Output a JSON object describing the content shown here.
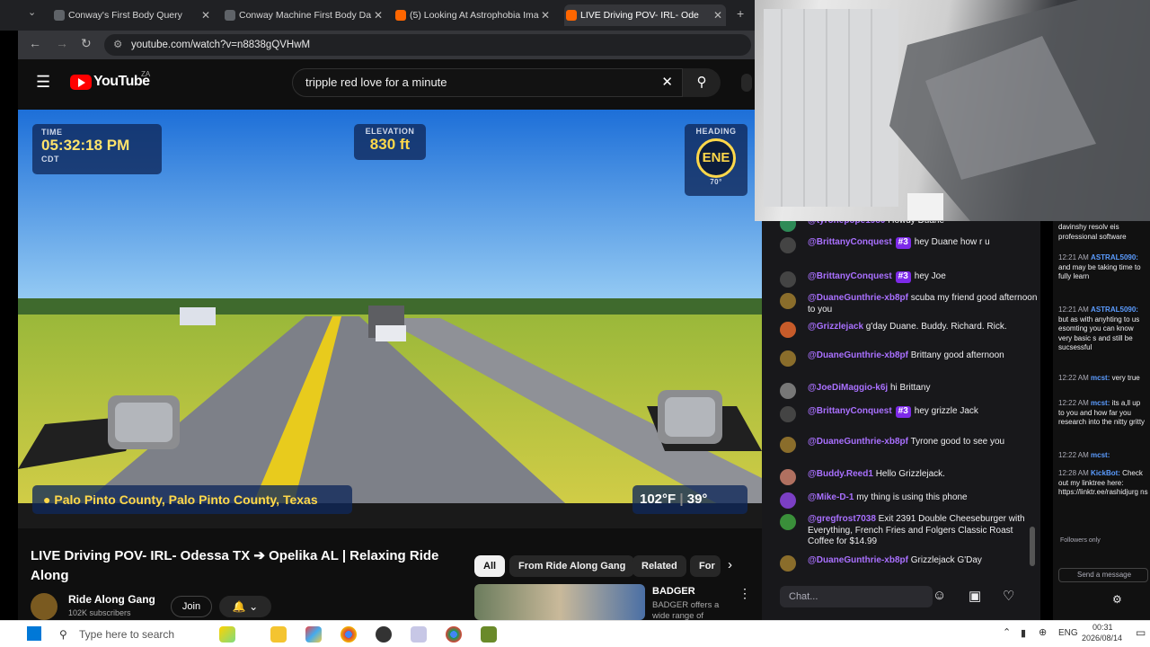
{
  "browser": {
    "tabs": [
      {
        "label": "Conway's First Body Query",
        "fav": "#5f6368"
      },
      {
        "label": "Conway Machine First Body Da",
        "fav": "#5f6368"
      },
      {
        "label": "(5) Looking At Astrophobia Ima",
        "fav": "#ff6600"
      },
      {
        "label": "LIVE Driving POV- IRL- Ode",
        "fav": "#ff6600"
      }
    ],
    "url": "youtube.com/watch?v=n8838gQVHwM"
  },
  "youtube": {
    "logo": "YouTube",
    "region": "ZA",
    "search_value": "tripple red love for a minute"
  },
  "overlay": {
    "time_label": "TIME",
    "time_value": "05:32:18 PM",
    "timezone": "CDT",
    "elevation_label": "ELEVATION",
    "elevation_value": "830 ft",
    "heading_label": "HEADING",
    "heading_value": "ENE",
    "heading_degrees": "70°",
    "location": "Palo Pinto County, Palo Pinto County, Texas",
    "temp_f": "102°F",
    "temp_c": "39°"
  },
  "video_info": {
    "title": "LIVE Driving POV- IRL- Odessa TX ➔ Opelika AL | Relaxing Ride Along",
    "channel": "Ride Along Gang",
    "subscribers": "102K subscribers",
    "join_label": "Join",
    "chips": [
      "All",
      "From Ride Along Gang",
      "Related",
      "For"
    ],
    "rec_title": "BADGER",
    "rec_desc": "BADGER offers a wide range of"
  },
  "chat": {
    "messages": [
      {
        "user": "@tyronepope1980",
        "text": "Howdy Duane",
        "av": "#2e8b57",
        "badge": ""
      },
      {
        "user": "@BrittanyConquest",
        "text": "hey Duane how r u",
        "av": "#444",
        "badge": "#3"
      },
      {
        "user": "@BrittanyConquest",
        "text": "hey Joe",
        "av": "#444",
        "badge": "#3"
      },
      {
        "user": "@DuaneGunthrie-xb8pf",
        "text": "scuba my friend good afternoon to you",
        "av": "#8a6d2b",
        "badge": ""
      },
      {
        "user": "@Grizzlejack",
        "text": "g'day Duane. Buddy. Richard. Rick.",
        "av": "#c75b2a",
        "badge": ""
      },
      {
        "user": "@DuaneGunthrie-xb8pf",
        "text": "Brittany good afternoon",
        "av": "#8a6d2b",
        "badge": ""
      },
      {
        "user": "@JoeDiMaggio-k6j",
        "text": "hi Brittany",
        "av": "#777",
        "badge": ""
      },
      {
        "user": "@BrittanyConquest",
        "text": "hey grizzle Jack",
        "av": "#444",
        "badge": "#3"
      },
      {
        "user": "@DuaneGunthrie-xb8pf",
        "text": "Tyrone good to see you",
        "av": "#8a6d2b",
        "badge": ""
      },
      {
        "user": "@Buddy.Reed1",
        "text": "Hello Grizzlejack.",
        "av": "#b07060",
        "badge": ""
      },
      {
        "user": "@Mike-D-1",
        "text": "my thing is using this phone",
        "av": "#7b3fc4",
        "badge": ""
      },
      {
        "user": "@gregfrost7038",
        "text": "Exit 2391 Double Cheeseburger with Everything, French Fries and Folgers Classic Roast Coffee for $14.99",
        "av": "#3a8f3a",
        "badge": ""
      },
      {
        "user": "@DuaneGunthrie-xb8pf",
        "text": "Grizzlejack G'Day",
        "av": "#8a6d2b",
        "badge": ""
      }
    ],
    "input_placeholder": "Chat..."
  },
  "rchat": {
    "messages": [
      {
        "time": "",
        "user": "",
        "text": "davinshy resolv eis professional software"
      },
      {
        "time": "12:21 AM",
        "user": "ASTRAL5090:",
        "text": "and may be taking time to fully learn"
      },
      {
        "time": "12:21 AM",
        "user": "ASTRAL5090:",
        "text": "but as with anyhting to us esomting you can know very basic s and still be sucsessful"
      },
      {
        "time": "12:22 AM",
        "user": "mcst:",
        "text": "very true"
      },
      {
        "time": "12:22 AM",
        "user": "mcst:",
        "text": "its a,ll up to you and how far you research into the nitty gritty"
      },
      {
        "time": "12:22 AM",
        "user": "mcst:",
        "text": ""
      },
      {
        "time": "12:28 AM",
        "user": "KickBot:",
        "text": "Check out my linktree here: https://linktr.ee/rashidjurg ns"
      }
    ],
    "followers_only": "Followers only",
    "send_placeholder": "Send a message"
  },
  "taskbar": {
    "search_placeholder": "Type here to search",
    "lang": "ENG",
    "time": "00:31",
    "date": "2026/08/14"
  }
}
